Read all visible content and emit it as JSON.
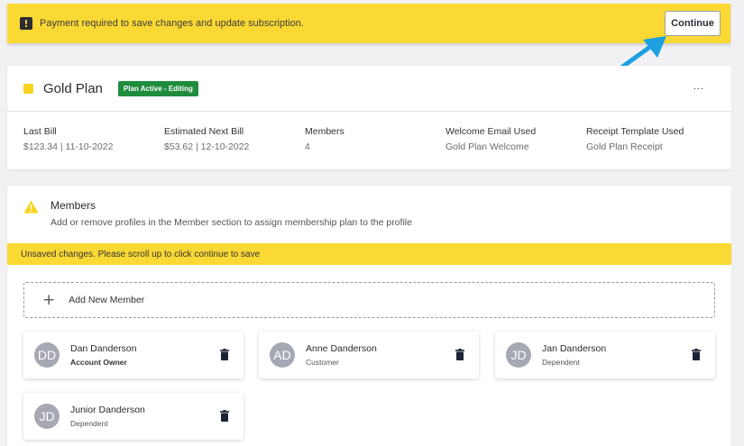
{
  "banner": {
    "icon": "exclamation-icon",
    "message": "Payment required to save changes and update subscription.",
    "continue_label": "Continue"
  },
  "plan": {
    "name": "Gold Plan",
    "badge": "Plan Active - Editing",
    "more_label": "...",
    "fields": [
      {
        "label": "Last Bill",
        "value": "$123.34 | 11-10-2022"
      },
      {
        "label": "Estimated Next Bill",
        "value": "$53.62 | 12-10-2022"
      },
      {
        "label": "Members",
        "value": "4"
      },
      {
        "label": "Welcome Email Used",
        "value": "Gold Plan Welcome"
      },
      {
        "label": "Receipt Template Used",
        "value": "Gold Plan Receipt"
      }
    ]
  },
  "members_section": {
    "title": "Members",
    "subtitle": "Add or remove profiles in the Member section to assign membership plan to the profile",
    "unsaved_notice": "Unsaved changes. Please scroll up to click continue to save",
    "add_label": "Add New Member",
    "members": [
      {
        "initials": "DD",
        "name": "Dan Danderson",
        "role": "Account Owner"
      },
      {
        "initials": "AD",
        "name": "Anne Danderson",
        "role": "Customer"
      },
      {
        "initials": "JD",
        "name": "Jan Danderson",
        "role": "Dependent"
      },
      {
        "initials": "JD",
        "name": "Junior Danderson",
        "role": "Dependent"
      }
    ]
  },
  "colors": {
    "banner": "#fbd934",
    "badge": "#1f8c3d",
    "avatar": "#a6a9b3",
    "arrow": "#1e9fe0"
  }
}
